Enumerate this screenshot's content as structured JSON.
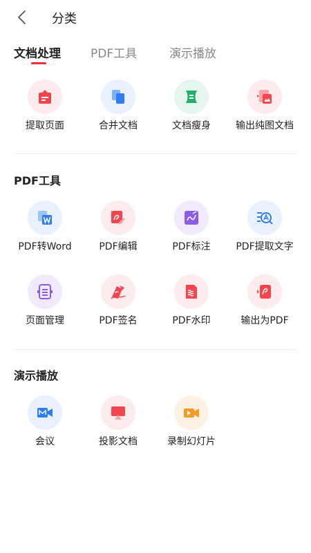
{
  "header": {
    "title": "分类",
    "back_icon": "chevron-left-icon"
  },
  "tabs": [
    {
      "label": "文档处理",
      "active": true
    },
    {
      "label": "PDF工具",
      "active": false
    },
    {
      "label": "演示播放",
      "active": false
    }
  ],
  "accent_color": "#e8303a",
  "sections": [
    {
      "title": "",
      "items": [
        {
          "label": "提取页面",
          "icon": "extract-page-icon"
        },
        {
          "label": "合并文档",
          "icon": "merge-document-icon"
        },
        {
          "label": "文档瘦身",
          "icon": "slim-document-icon"
        },
        {
          "label": "输出纯图文档",
          "icon": "export-image-doc-icon"
        }
      ]
    },
    {
      "title": "PDF工具",
      "items": [
        {
          "label": "PDF转Word",
          "icon": "pdf-to-word-icon"
        },
        {
          "label": "PDF编辑",
          "icon": "pdf-edit-icon"
        },
        {
          "label": "PDF标注",
          "icon": "pdf-annotate-icon"
        },
        {
          "label": "PDF提取文字",
          "icon": "pdf-extract-text-icon"
        },
        {
          "label": "页面管理",
          "icon": "page-manage-icon"
        },
        {
          "label": "PDF签名",
          "icon": "pdf-sign-icon"
        },
        {
          "label": "PDF水印",
          "icon": "pdf-watermark-icon"
        },
        {
          "label": "输出为PDF",
          "icon": "export-pdf-icon"
        }
      ]
    },
    {
      "title": "演示播放",
      "items": [
        {
          "label": "会议",
          "icon": "meeting-icon"
        },
        {
          "label": "投影文档",
          "icon": "projection-icon"
        },
        {
          "label": "录制幻灯片",
          "icon": "record-slides-icon"
        }
      ]
    }
  ]
}
